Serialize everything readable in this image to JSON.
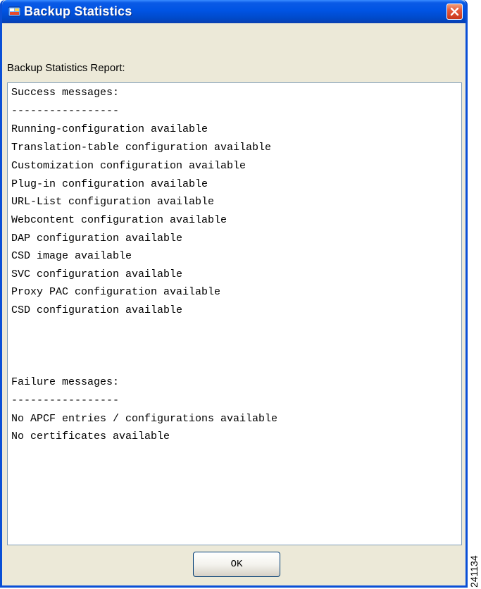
{
  "window": {
    "title": "Backup Statistics",
    "title_icon": "app-icon",
    "close_icon": "close-icon"
  },
  "report_label": "Backup Statistics Report:",
  "report_lines": [
    "Success messages:",
    "-----------------",
    "Running-configuration available",
    "Translation-table configuration available",
    "Customization configuration available",
    "Plug-in configuration available",
    "URL-List configuration available",
    "Webcontent configuration available",
    "DAP configuration available",
    "CSD image available",
    "SVC configuration available",
    "Proxy PAC configuration available",
    "CSD configuration available",
    "",
    "",
    "",
    "Failure messages:",
    "-----------------",
    "No APCF entries / configurations available",
    "No certificates available"
  ],
  "ok_label": "OK",
  "figure_id": "241134"
}
